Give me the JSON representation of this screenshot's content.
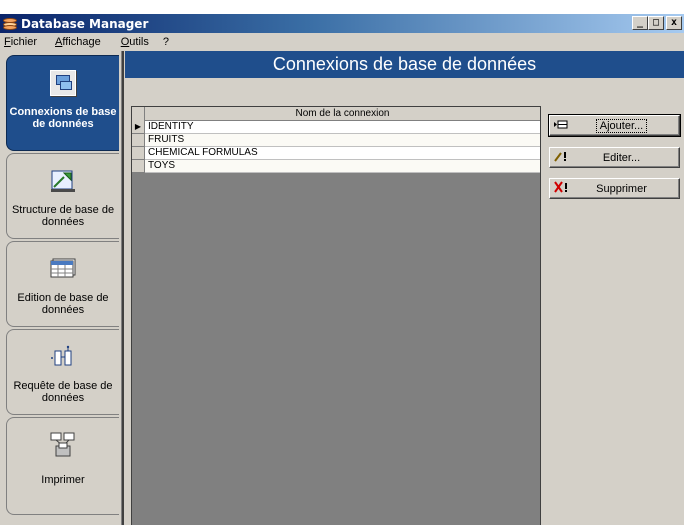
{
  "window": {
    "title": "Database Manager",
    "controls": {
      "minimize": "_",
      "maximize": "□",
      "close": "x"
    }
  },
  "menu": [
    {
      "label": "Fichier"
    },
    {
      "label": "Affichage"
    },
    {
      "label": "Outils"
    },
    {
      "label": "?"
    }
  ],
  "nav": [
    {
      "label": "Connexions de base de données",
      "icon": "database-connection-icon",
      "active": true
    },
    {
      "label": "Structure de base de données",
      "icon": "structure-design-icon",
      "active": false
    },
    {
      "label": "Edition de base de données",
      "icon": "table-edit-icon",
      "active": false
    },
    {
      "label": "Requête de base de données",
      "icon": "query-icon",
      "active": false
    },
    {
      "label": "Imprimer",
      "icon": "printer-icon",
      "active": false
    }
  ],
  "panel": {
    "title": "Connexions de base de données",
    "grid": {
      "column": "Nom de la connexion",
      "rows": [
        "IDENTITY",
        "FRUITS",
        "CHEMICAL FORMULAS",
        "TOYS"
      ],
      "selected_marker": "▶"
    },
    "buttons": {
      "add": "Ajouter...",
      "edit": "Editer...",
      "delete": "Supprimer"
    }
  },
  "colors": {
    "accent": "#1f4e8c",
    "titlebar_start": "#0a246a",
    "face": "#d4d0c8",
    "grid_bg": "#808080"
  }
}
